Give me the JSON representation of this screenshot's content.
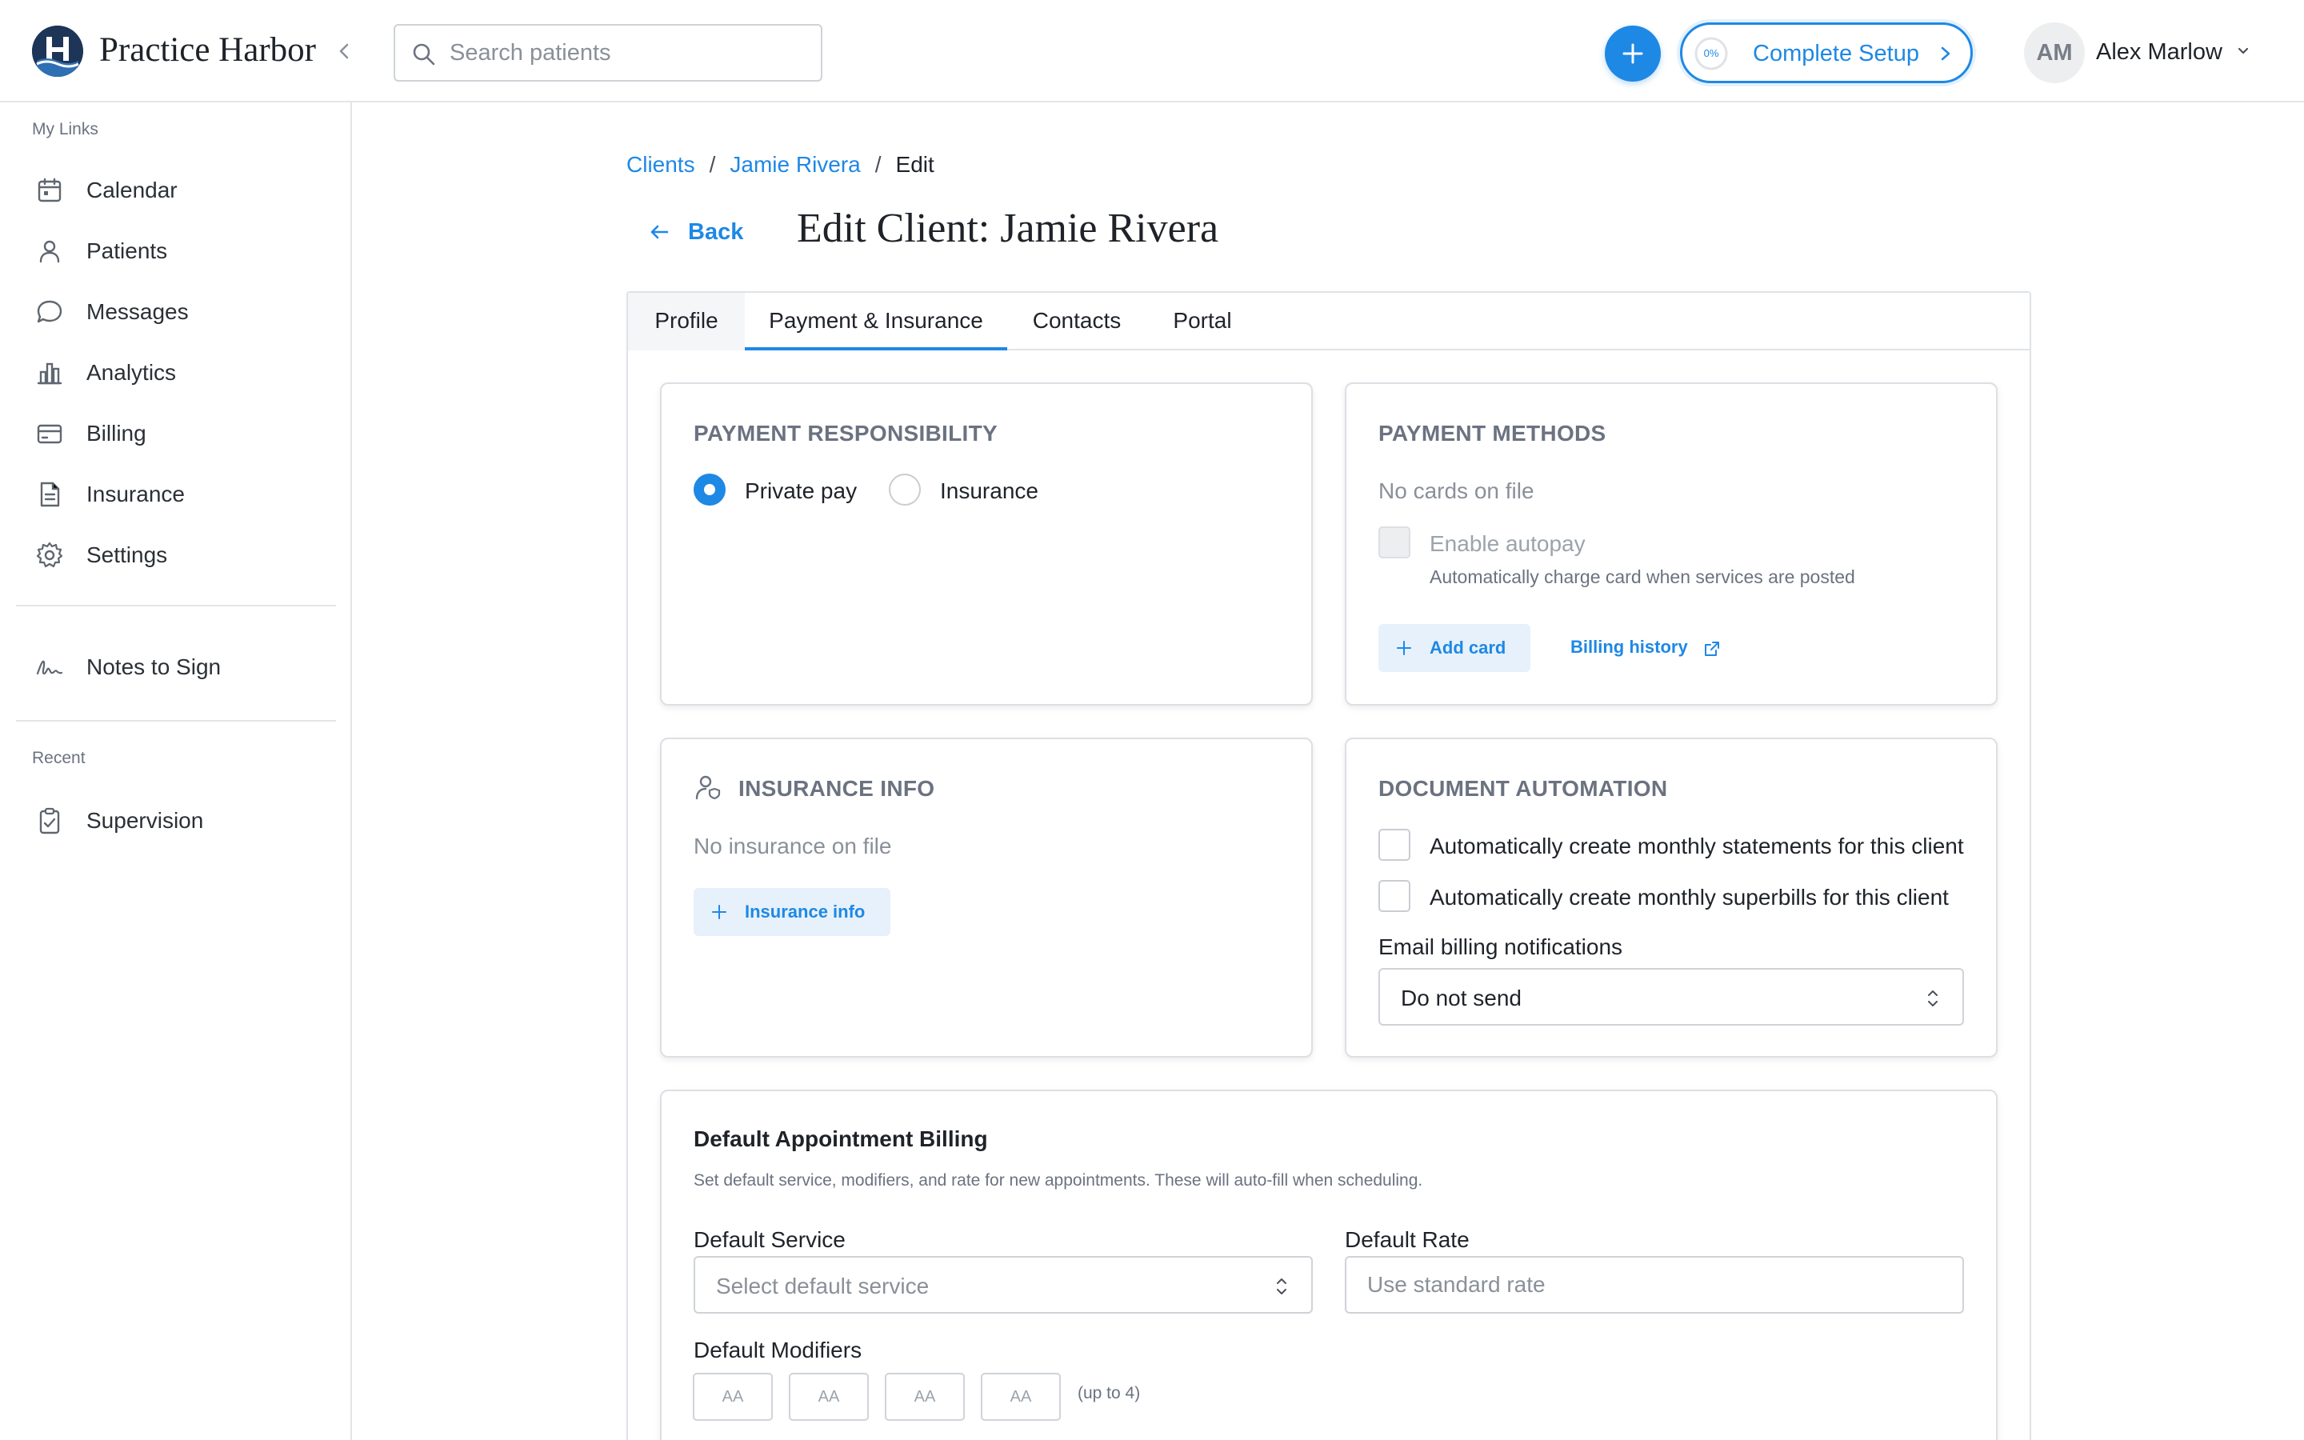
{
  "app": {
    "brand": "Practice Harbor"
  },
  "header": {
    "search_placeholder": "Search patients",
    "setup": {
      "label": "Complete Setup",
      "progress_text": "0%",
      "progress": 0
    },
    "user": {
      "initials": "AM",
      "name": "Alex Marlow"
    }
  },
  "sidebar": {
    "my_links_label": "My Links",
    "items": [
      {
        "label": "Calendar",
        "icon": "calendar-icon"
      },
      {
        "label": "Patients",
        "icon": "user-icon"
      },
      {
        "label": "Messages",
        "icon": "chat-bubble-icon"
      },
      {
        "label": "Analytics",
        "icon": "bar-chart-icon"
      },
      {
        "label": "Billing",
        "icon": "credit-card-icon"
      },
      {
        "label": "Insurance",
        "icon": "document-icon"
      },
      {
        "label": "Settings",
        "icon": "gear-icon"
      }
    ],
    "notes_to_sign": {
      "label": "Notes to Sign",
      "icon": "signature-icon"
    },
    "recent_label": "Recent",
    "recent_items": [
      {
        "label": "Supervision",
        "icon": "clipboard-check-icon"
      }
    ]
  },
  "breadcrumb": {
    "items": [
      "Clients",
      "Jamie Rivera"
    ],
    "separator": "/",
    "current": "Edit"
  },
  "page": {
    "back_label": "Back",
    "title": "Edit Client: Jamie Rivera"
  },
  "tabs": [
    {
      "label": "Profile",
      "active": false
    },
    {
      "label": "Payment & Insurance",
      "active": true
    },
    {
      "label": "Contacts",
      "active": false
    },
    {
      "label": "Portal",
      "active": false
    }
  ],
  "payment_responsibility": {
    "title": "PAYMENT RESPONSIBILITY",
    "options": [
      {
        "label": "Private pay",
        "selected": true
      },
      {
        "label": "Insurance",
        "selected": false
      }
    ]
  },
  "payment_methods": {
    "title": "PAYMENT METHODS",
    "empty_text": "No cards on file",
    "autopay_label": "Enable autopay",
    "autopay_help": "Automatically charge card when services are posted",
    "add_card_label": "Add card",
    "billing_history_label": "Billing history"
  },
  "insurance_info": {
    "title": "INSURANCE INFO",
    "empty_text": "No insurance on file",
    "add_button_label": "Insurance info"
  },
  "document_automation": {
    "title": "DOCUMENT AUTOMATION",
    "options": [
      {
        "label": "Automatically create monthly statements for this client",
        "checked": false
      },
      {
        "label": "Automatically create monthly superbills for this client",
        "checked": false
      }
    ],
    "email_label": "Email billing notifications",
    "email_value": "Do not send"
  },
  "default_billing": {
    "title": "Default Appointment Billing",
    "description": "Set default service, modifiers, and rate for new appointments. These will auto-fill when scheduling.",
    "service_label": "Default Service",
    "service_placeholder": "Select default service",
    "rate_label": "Default Rate",
    "rate_placeholder": "Use standard rate",
    "modifiers_label": "Default Modifiers",
    "modifier_placeholder": "AA",
    "modifiers_hint": "(up to 4)"
  },
  "colors": {
    "accent": "#1e88e5",
    "brand_dark": "#1d3557",
    "muted_text": "#8a9099"
  }
}
